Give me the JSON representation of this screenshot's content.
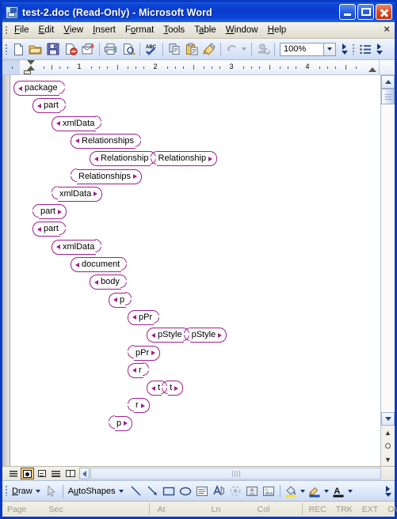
{
  "window": {
    "title": "test-2.doc (Read-Only) - Microsoft Word",
    "icon": "word-document-icon",
    "controls": {
      "minimize": "Minimize",
      "maximize": "Restore",
      "close": "Close"
    }
  },
  "menubar": {
    "items": [
      "File",
      "Edit",
      "View",
      "Insert",
      "Format",
      "Tools",
      "Table",
      "Window",
      "Help"
    ],
    "close_document": "×"
  },
  "toolbar": {
    "buttons": [
      "new-blank-document",
      "open",
      "save",
      "permission",
      "email",
      "print",
      "print-preview",
      "spelling-and-grammar",
      "copy",
      "paste",
      "format-painter",
      "undo",
      "insert-hyperlink"
    ],
    "zoom_value": "100%",
    "overflow": "toolbar-options"
  },
  "ruler": {
    "numbers": [
      "1",
      "2",
      "3",
      "4"
    ],
    "left_indent_marker": "first-line-indent",
    "unit": "inches"
  },
  "document": {
    "xml_tree": [
      {
        "name": "package",
        "indent": 0,
        "type": "open"
      },
      {
        "name": "part",
        "indent": 1,
        "type": "open"
      },
      {
        "name": "xmlData",
        "indent": 2,
        "type": "open"
      },
      {
        "name": "Relationships",
        "indent": 3,
        "type": "open"
      },
      {
        "name": "Relationship",
        "indent": 4,
        "type": "pair"
      },
      {
        "name": "Relationships",
        "indent": 3,
        "type": "close"
      },
      {
        "name": "xmlData",
        "indent": 2,
        "type": "close"
      },
      {
        "name": "part",
        "indent": 1,
        "type": "close"
      },
      {
        "name": "part",
        "indent": 1,
        "type": "open"
      },
      {
        "name": "xmlData",
        "indent": 2,
        "type": "open"
      },
      {
        "name": "document",
        "indent": 3,
        "type": "open"
      },
      {
        "name": "body",
        "indent": 4,
        "type": "open"
      },
      {
        "name": "p",
        "indent": 5,
        "type": "open"
      },
      {
        "name": "pPr",
        "indent": 6,
        "type": "open"
      },
      {
        "name": "pStyle",
        "indent": 7,
        "type": "pair"
      },
      {
        "name": "pPr",
        "indent": 6,
        "type": "close"
      },
      {
        "name": "r",
        "indent": 6,
        "type": "open"
      },
      {
        "name": "t",
        "indent": 7,
        "type": "pair"
      },
      {
        "name": "r",
        "indent": 6,
        "type": "close"
      },
      {
        "name": "p",
        "indent": 5,
        "type": "close"
      }
    ],
    "tag_border_color": "#9E1F8C",
    "page_background": "#FFFFFF"
  },
  "view_bar": {
    "buttons": [
      "normal-view",
      "web-layout-view",
      "print-layout-view",
      "outline-view",
      "reading-layout-view"
    ],
    "selected": "web-layout-view"
  },
  "drawing_toolbar": {
    "draw_label": "Draw",
    "autoshapes_label": "AutoShapes",
    "tools": [
      "select-objects",
      "line",
      "arrow",
      "rectangle",
      "oval",
      "text-box",
      "wordart",
      "diagram",
      "clip-art",
      "picture",
      "fill-color",
      "line-color",
      "font-color"
    ]
  },
  "status_bar": {
    "fields": [
      "Page",
      "Sec",
      "At",
      "Ln",
      "Col"
    ],
    "modes": [
      "REC",
      "TRK",
      "EXT",
      "OVR"
    ]
  }
}
